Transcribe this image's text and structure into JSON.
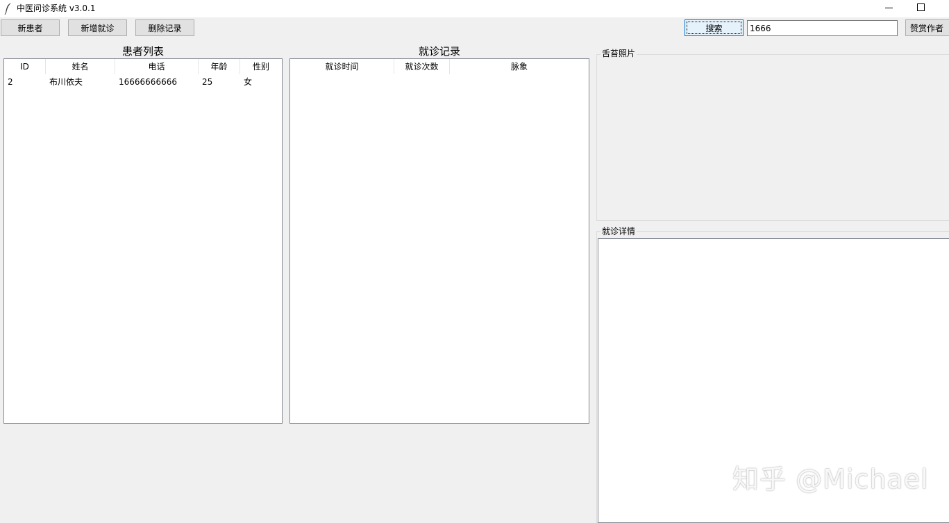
{
  "window": {
    "title": "中医问诊系统 v3.0.1",
    "app_icon": "feather-icon"
  },
  "toolbar": {
    "new_patient_label": "新患者",
    "new_visit_label": "新增就诊",
    "delete_record_label": "删除记录",
    "search_label": "搜索",
    "search_value": "1666",
    "donate_label": "赞赏作者"
  },
  "patients": {
    "title": "患者列表",
    "columns": [
      "ID",
      "姓名",
      "电话",
      "年龄",
      "性别"
    ],
    "rows": [
      [
        "2",
        "布川依夫",
        "16666666666",
        "25",
        "女"
      ]
    ]
  },
  "visits": {
    "title": "就诊记录",
    "columns": [
      "就诊时间",
      "就诊次数",
      "脉象"
    ],
    "rows": []
  },
  "tongue_photo": {
    "label": "舌苔照片"
  },
  "visit_detail": {
    "label": "就诊详情"
  },
  "watermark": "知乎 @Michael"
}
